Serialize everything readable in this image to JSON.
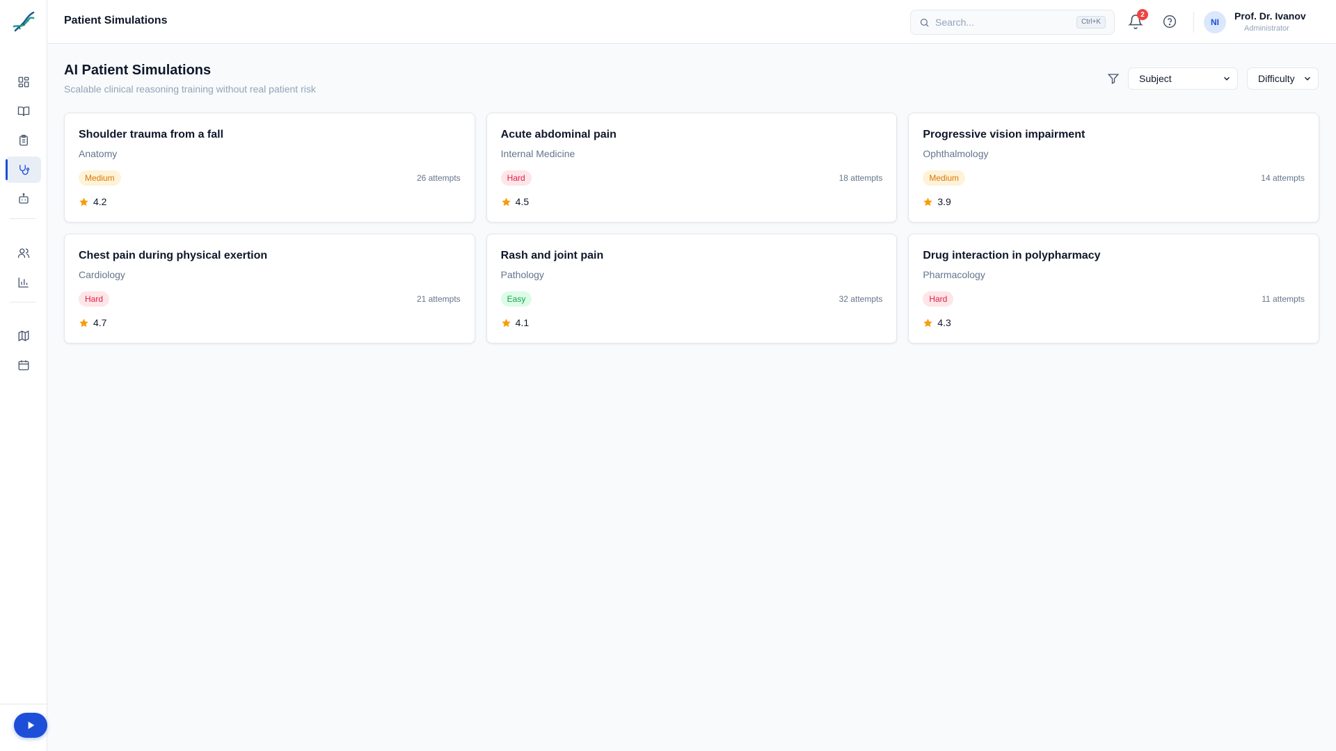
{
  "header": {
    "title": "Patient Simulations",
    "search_placeholder": "Search...",
    "search_shortcut": "Ctrl+K",
    "notification_count": "2",
    "user": {
      "initials": "NI",
      "name": "Prof. Dr. Ivanov",
      "role": "Administrator"
    }
  },
  "sidebar": {
    "items": [
      {
        "icon": "dashboard-icon",
        "active": false
      },
      {
        "icon": "book-icon",
        "active": false
      },
      {
        "icon": "clipboard-icon",
        "active": false
      },
      {
        "icon": "stethoscope-icon",
        "active": true
      },
      {
        "icon": "bot-icon",
        "active": false
      },
      {
        "icon": "users-icon",
        "active": false
      },
      {
        "icon": "bar-chart-icon",
        "active": false
      },
      {
        "icon": "map-icon",
        "active": false
      },
      {
        "icon": "calendar-icon",
        "active": false
      }
    ],
    "bottom_action_icon": "play-icon"
  },
  "page": {
    "title": "AI Patient Simulations",
    "subtitle": "Scalable clinical reasoning training without real patient risk"
  },
  "filters": {
    "subject_label": "Subject",
    "difficulty_label": "Difficulty"
  },
  "cards": [
    {
      "title": "Shoulder trauma from a fall",
      "subject": "Anatomy",
      "difficulty": "Medium",
      "attempts": "26 attempts",
      "rating": "4.2"
    },
    {
      "title": "Acute abdominal pain",
      "subject": "Internal Medicine",
      "difficulty": "Hard",
      "attempts": "18 attempts",
      "rating": "4.5"
    },
    {
      "title": "Progressive vision impairment",
      "subject": "Ophthalmology",
      "difficulty": "Medium",
      "attempts": "14 attempts",
      "rating": "3.9"
    },
    {
      "title": "Chest pain during physical exertion",
      "subject": "Cardiology",
      "difficulty": "Hard",
      "attempts": "21 attempts",
      "rating": "4.7"
    },
    {
      "title": "Rash and joint pain",
      "subject": "Pathology",
      "difficulty": "Easy",
      "attempts": "32 attempts",
      "rating": "4.1"
    },
    {
      "title": "Drug interaction in polypharmacy",
      "subject": "Pharmacology",
      "difficulty": "Hard",
      "attempts": "11 attempts",
      "rating": "4.3"
    }
  ],
  "colors": {
    "accent": "#1d4ed8",
    "medium": "#d97706",
    "hard": "#e11d48",
    "easy": "#16a34a",
    "star": "#f59e0b"
  }
}
